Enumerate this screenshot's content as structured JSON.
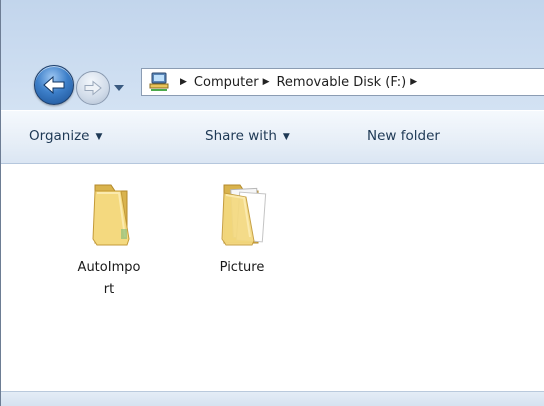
{
  "navigation": {
    "back_icon": "back-arrow-icon",
    "forward_icon": "forward-arrow-icon",
    "dropdown_icon": "recent-pages-dropdown-icon"
  },
  "address": {
    "crumbs": [
      "Computer",
      "Removable Disk (F:)"
    ]
  },
  "toolbar": {
    "organize_label": "Organize",
    "share_label": "Share with",
    "new_folder_label": "New folder"
  },
  "files": [
    {
      "name": "AutoImpo\nrt",
      "icon": "folder-icon"
    },
    {
      "name": "Picture",
      "icon": "folder-with-documents-icon"
    }
  ],
  "colors": {
    "title_glass": "#c2d5ec",
    "command_bar": "#e9f0f8",
    "command_text": "#1e3955",
    "folder_yellow": "#f2d57b"
  }
}
